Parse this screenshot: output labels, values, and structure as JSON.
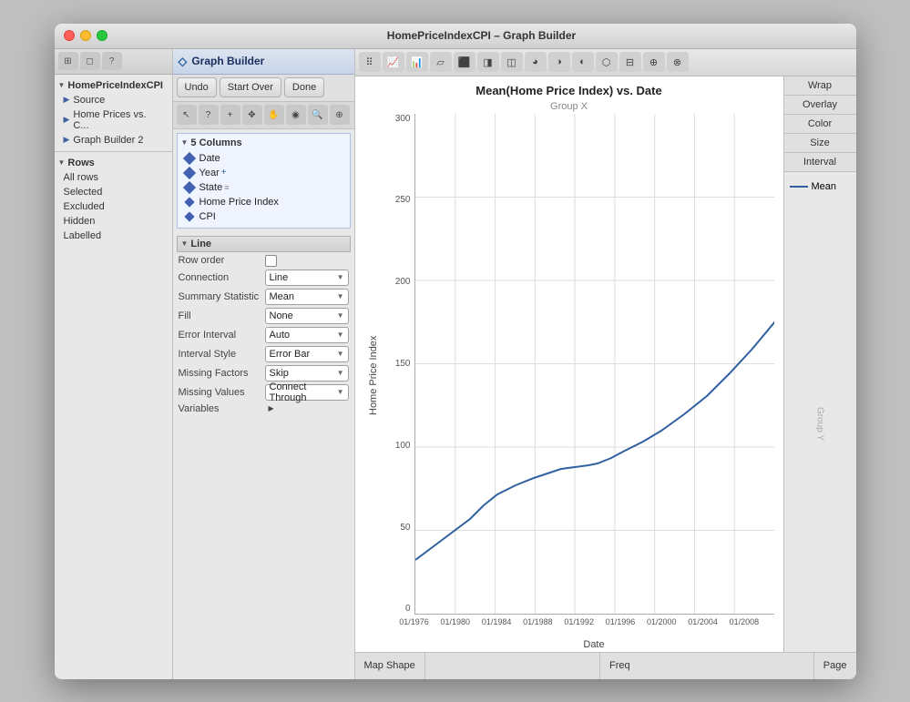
{
  "window": {
    "title": "HomePriceIndexCPI – Graph Builder"
  },
  "toolbar": {
    "undo_label": "Undo",
    "startover_label": "Start Over",
    "done_label": "Done"
  },
  "left_panel": {
    "header": "HomePriceIndexCPI",
    "source_label": "Source",
    "home_prices_label": "Home Prices vs. C...",
    "graph_builder_label": "Graph Builder 2",
    "rows_header": "Rows",
    "rows_items": [
      "All rows",
      "Selected",
      "Excluded",
      "Hidden",
      "Labelled"
    ]
  },
  "columns_section": {
    "header": "5 Columns",
    "items": [
      {
        "name": "Date",
        "type": "date"
      },
      {
        "name": "Year",
        "type": "date"
      },
      {
        "name": "State",
        "type": "nominal"
      },
      {
        "name": "Home Price Index",
        "type": "continuous"
      },
      {
        "name": "CPI",
        "type": "continuous"
      }
    ]
  },
  "graph_builder": {
    "header": "Graph Builder"
  },
  "line_section": {
    "header": "Line",
    "fields": [
      {
        "label": "Row order",
        "value": "",
        "type": "checkbox"
      },
      {
        "label": "Connection",
        "value": "Line",
        "type": "dropdown"
      },
      {
        "label": "Summary Statistic",
        "value": "Mean",
        "type": "dropdown"
      },
      {
        "label": "Fill",
        "value": "None",
        "type": "dropdown"
      },
      {
        "label": "Error Interval",
        "value": "Auto",
        "type": "dropdown"
      },
      {
        "label": "Interval Style",
        "value": "Error Bar",
        "type": "dropdown"
      },
      {
        "label": "Missing Factors",
        "value": "Skip",
        "type": "dropdown"
      },
      {
        "label": "Missing Values",
        "value": "Connect Through",
        "type": "dropdown"
      }
    ],
    "variables_label": "Variables"
  },
  "chart": {
    "title": "Mean(Home Price Index) vs. Date",
    "group_x_label": "Group X",
    "group_y_label": "Group Y",
    "y_axis_label": "Home Price Index",
    "x_axis_label": "Date",
    "wrap_label": "Wrap",
    "overlay_label": "Overlay",
    "color_label": "Color",
    "size_label": "Size",
    "interval_label": "Interval",
    "legend_label": "Mean",
    "map_shape_label": "Map Shape",
    "freq_label": "Freq",
    "page_label": "Page",
    "y_ticks": [
      "0",
      "50",
      "100",
      "150",
      "200",
      "250",
      "300"
    ],
    "x_ticks": [
      "01/1976",
      "01/1980",
      "01/1984",
      "01/1988",
      "01/1992",
      "01/1996",
      "01/2000",
      "01/2004",
      "01/2008"
    ]
  }
}
